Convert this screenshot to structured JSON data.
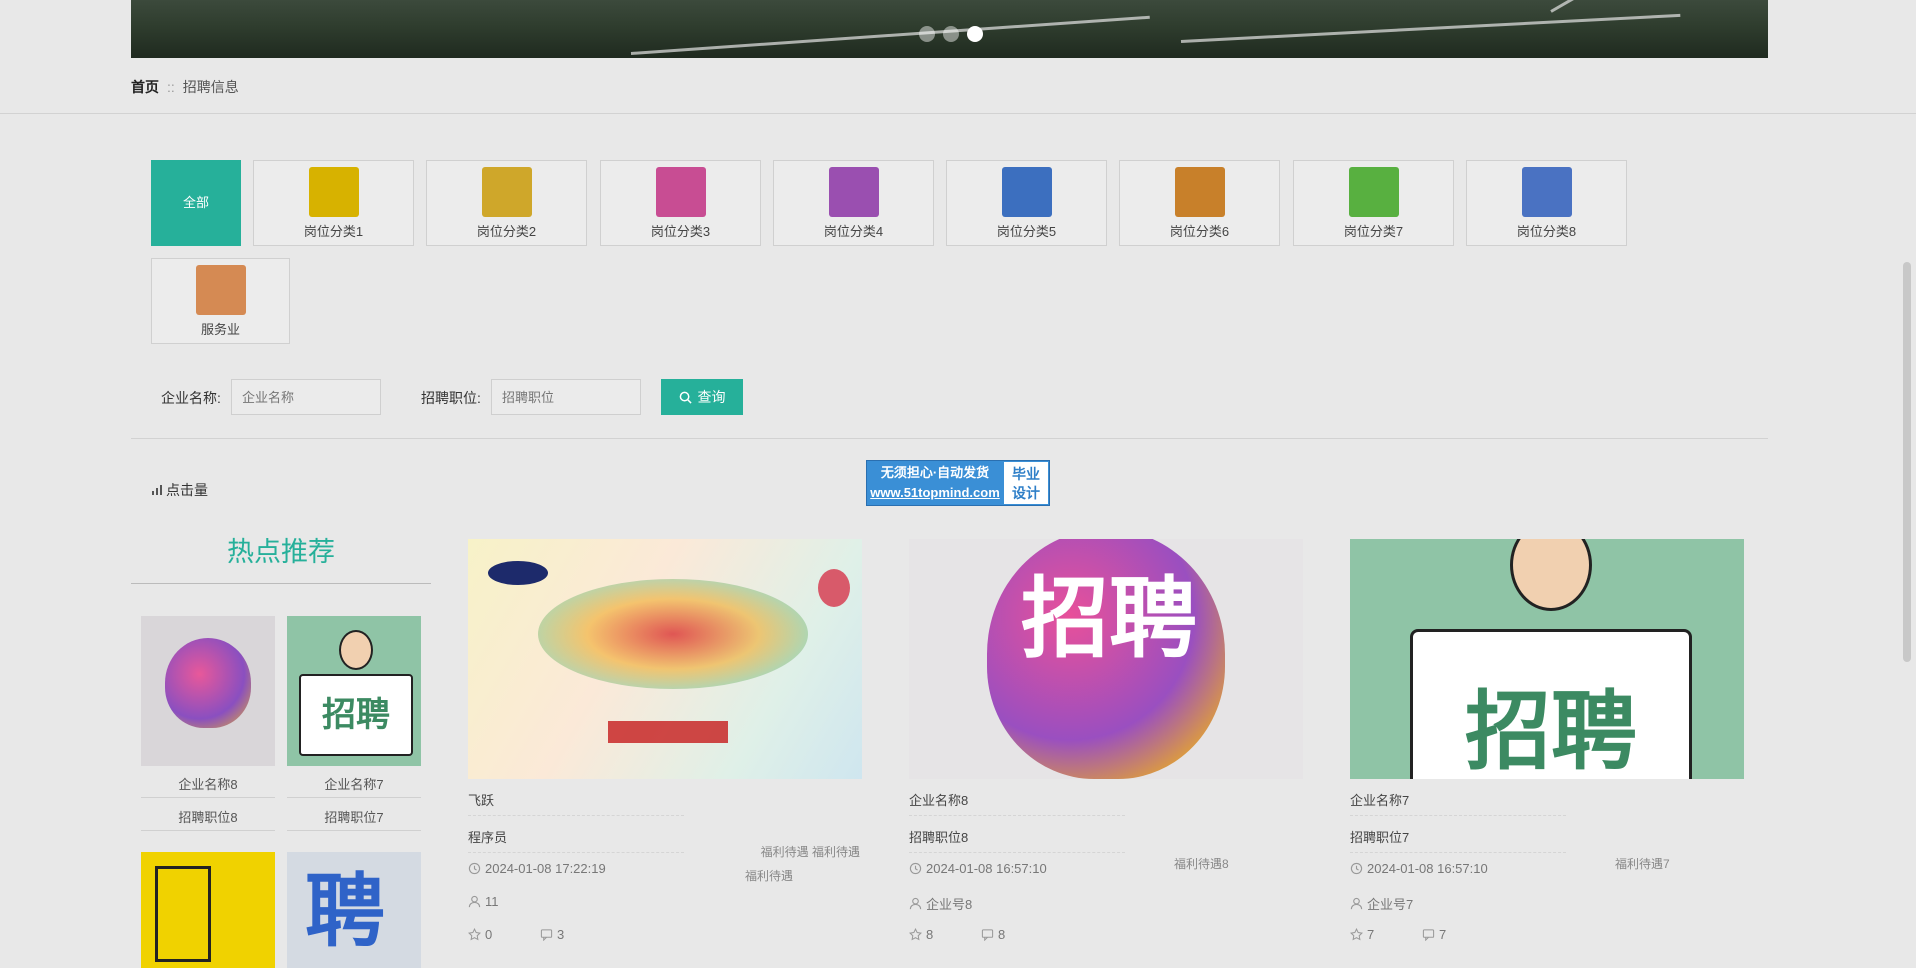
{
  "banner": {
    "slides": 3,
    "active_index": 2
  },
  "breadcrumb": {
    "home": "首页",
    "separator": "::",
    "current": "招聘信息"
  },
  "categories": [
    {
      "label": "全部",
      "active": true
    },
    {
      "label": "岗位分类1",
      "thumb_color": "#d7b200"
    },
    {
      "label": "岗位分类2",
      "thumb_color": "#cfa72a"
    },
    {
      "label": "岗位分类3",
      "thumb_color": "#c84d93"
    },
    {
      "label": "岗位分类4",
      "thumb_color": "#9a4fb0"
    },
    {
      "label": "岗位分类5",
      "thumb_color": "#3c6fbf"
    },
    {
      "label": "岗位分类6",
      "thumb_color": "#c8802a"
    },
    {
      "label": "岗位分类7",
      "thumb_color": "#58b040"
    },
    {
      "label": "岗位分类8",
      "thumb_color": "#4a72c2"
    },
    {
      "label": "服务业",
      "thumb_color": "#d58a53"
    }
  ],
  "filters": {
    "company_label": "企业名称:",
    "company_placeholder": "企业名称",
    "position_label": "招聘职位:",
    "position_placeholder": "招聘职位",
    "search_label": "查询"
  },
  "sort": {
    "label": "点击量"
  },
  "ad": {
    "line1": "无须担心·自动发货",
    "line2": "www.51topmind.com",
    "right_top": "毕业",
    "right_bottom": "设计"
  },
  "hot": {
    "title": "热点推荐",
    "items": [
      {
        "company": "企业名称8",
        "position": "招聘职位8",
        "color": "#c75ea9"
      },
      {
        "company": "企业名称7",
        "position": "招聘职位7",
        "color": "#8fc4a6"
      },
      {
        "color": "#f0d200"
      },
      {
        "color": "#2f63c8"
      }
    ]
  },
  "cards": [
    {
      "company": "飞跃",
      "position": "程序员",
      "time": "2024-01-08 17:22:19",
      "account": "11",
      "likes": "0",
      "comments": "3",
      "welfare": [
        "福利待遇 福利待遇",
        "福利待遇"
      ]
    },
    {
      "company": "企业名称8",
      "position": "招聘职位8",
      "time": "2024-01-08 16:57:10",
      "account": "企业号8",
      "likes": "8",
      "comments": "8",
      "welfare": [
        "福利待遇8"
      ]
    },
    {
      "company": "企业名称7",
      "position": "招聘职位7",
      "time": "2024-01-08 16:57:10",
      "account": "企业号7",
      "likes": "7",
      "comments": "7",
      "welfare": [
        "福利待遇7"
      ]
    }
  ]
}
